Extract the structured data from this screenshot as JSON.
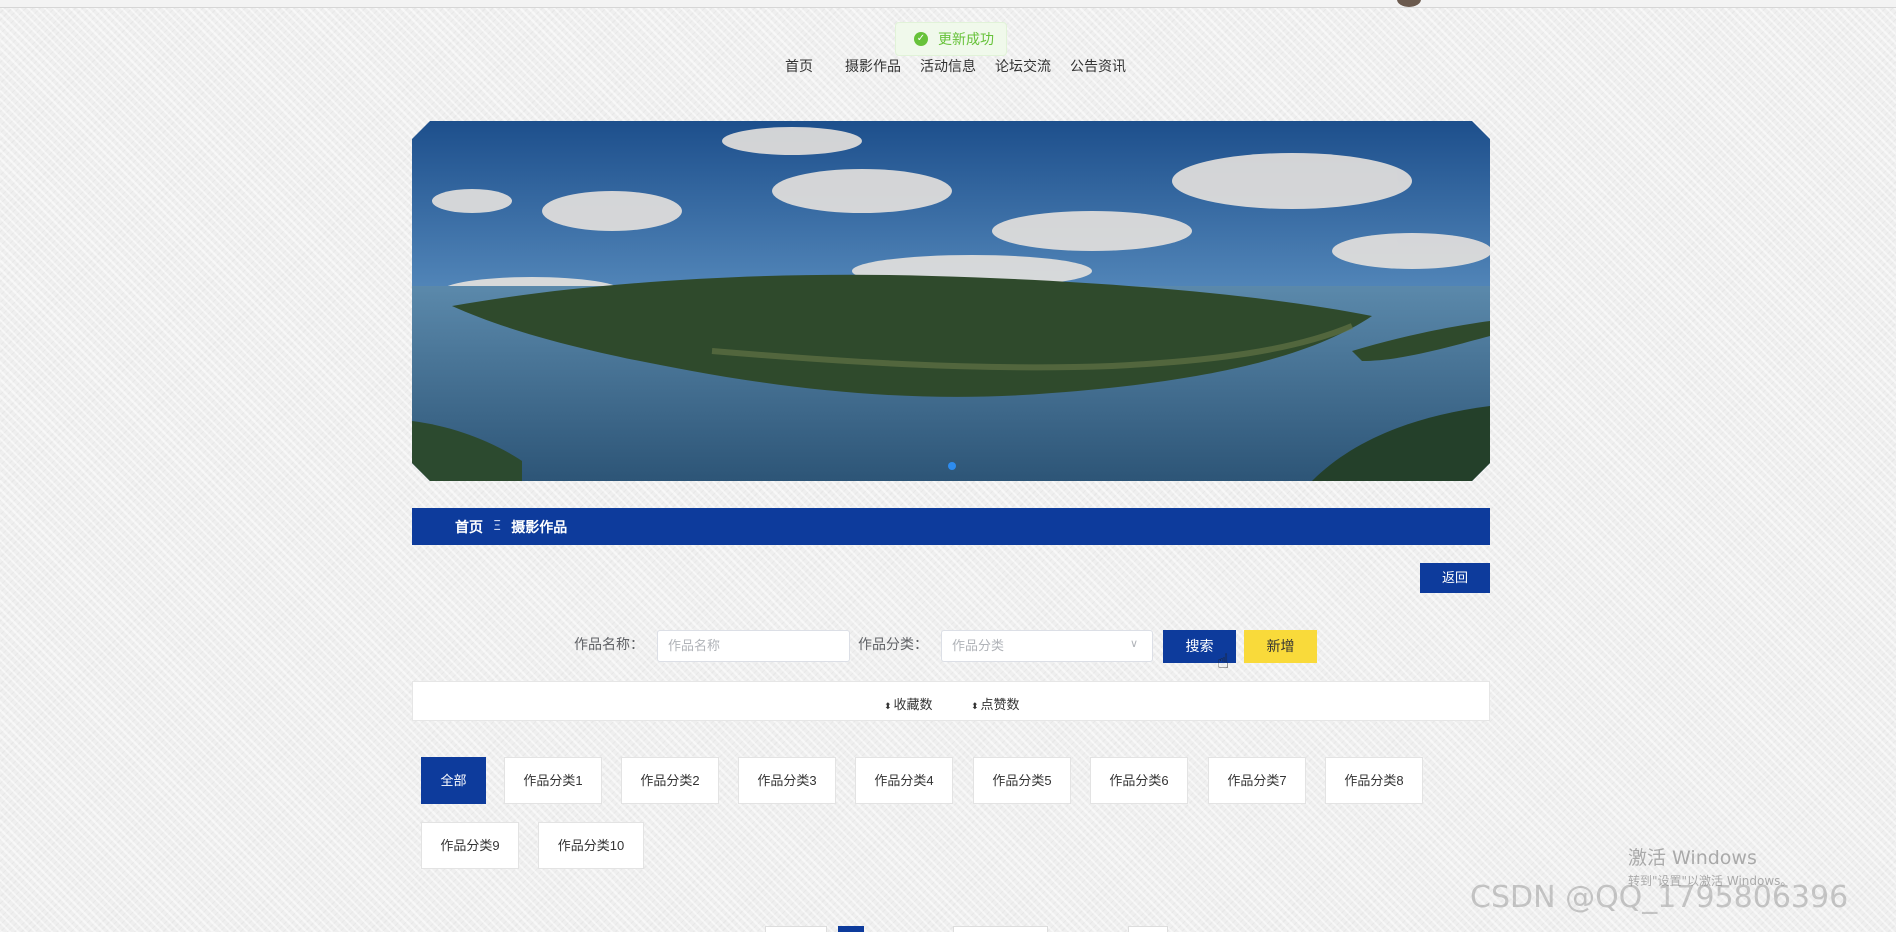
{
  "toast": {
    "text": "更新成功",
    "icon": "check-circle-icon"
  },
  "nav": {
    "items": [
      "首页",
      "摄影作品",
      "活动信息",
      "论坛交流",
      "公告资讯"
    ]
  },
  "breadcrumb": {
    "home": "首页",
    "separator": "Ξ",
    "current": "摄影作品"
  },
  "back_label": "返回",
  "search": {
    "name_label": "作品名称：",
    "name_placeholder": "作品名称",
    "category_label": "作品分类：",
    "category_placeholder": "作品分类",
    "search_label": "搜索",
    "add_label": "新增"
  },
  "sort": {
    "favorites": "收藏数",
    "likes": "点赞数"
  },
  "categories": [
    "全部",
    "作品分类1",
    "作品分类2",
    "作品分类3",
    "作品分类4",
    "作品分类5",
    "作品分类6",
    "作品分类7",
    "作品分类8",
    "作品分类9",
    "作品分类10"
  ],
  "windows": {
    "title": "激活 Windows",
    "subtitle": "转到\"设置\"以激活 Windows。"
  },
  "watermark": "CSDN @QQ_1795806396",
  "colors": {
    "primary": "#0d3b9c",
    "accent_yellow": "#f9da3a",
    "success": "#67c23a"
  }
}
